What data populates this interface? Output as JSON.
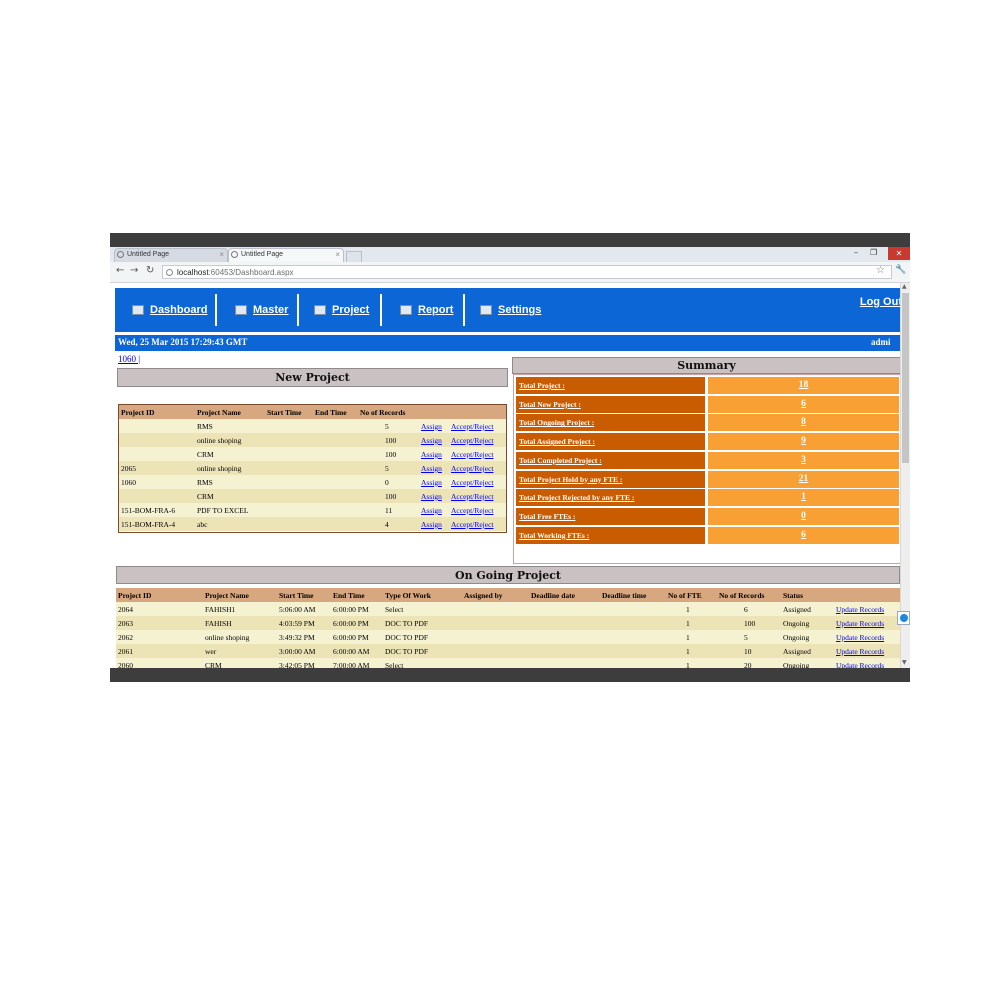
{
  "browser": {
    "tabs": [
      {
        "label": "Untitled Page"
      },
      {
        "label": "Untitled Page"
      }
    ],
    "url_host": "localhost",
    "url_path": ":60453/Dashboard.aspx"
  },
  "nav": {
    "items": [
      {
        "label": "Dashboard",
        "icon": "monitor-icon"
      },
      {
        "label": "Master",
        "icon": "monitor-icon"
      },
      {
        "label": "Project",
        "icon": "project-icon"
      },
      {
        "label": "Report",
        "icon": "report-icon"
      },
      {
        "label": "Settings",
        "icon": "settings-icon"
      }
    ],
    "logout": "Log Out"
  },
  "datebar": {
    "date": "Wed, 25 Mar 2015 17:29:43 GMT",
    "user": "admi"
  },
  "breadcrumb_link": "1060 |",
  "new_project": {
    "title": "New Project",
    "columns": [
      "Project ID",
      "Project Name",
      "Start Time",
      "End Time",
      "No of Records"
    ],
    "rows": [
      {
        "id": "",
        "name": "RMS",
        "start": "",
        "end": "",
        "records": "5",
        "assign": "Assign",
        "accept": "Accept/Reject"
      },
      {
        "id": "",
        "name": "online shoping",
        "start": "",
        "end": "",
        "records": "100",
        "assign": "Assign",
        "accept": "Accept/Reject"
      },
      {
        "id": "",
        "name": "CRM",
        "start": "",
        "end": "",
        "records": "100",
        "assign": "Assign",
        "accept": "Accept/Reject"
      },
      {
        "id": "2065",
        "name": "online shoping",
        "start": "",
        "end": "",
        "records": "5",
        "assign": "Assign",
        "accept": "Accept/Reject"
      },
      {
        "id": "1060",
        "name": "RMS",
        "start": "",
        "end": "",
        "records": "0",
        "assign": "Assign",
        "accept": "Accept/Reject"
      },
      {
        "id": "",
        "name": "CRM",
        "start": "",
        "end": "",
        "records": "100",
        "assign": "Assign",
        "accept": "Accept/Reject"
      },
      {
        "id": "151-BOM-FRA-6",
        "name": "PDF TO EXCEL",
        "start": "",
        "end": "",
        "records": "11",
        "assign": "Assign",
        "accept": "Accept/Reject"
      },
      {
        "id": "151-BOM-FRA-4",
        "name": "abc",
        "start": "",
        "end": "",
        "records": "4",
        "assign": "Assign",
        "accept": "Accept/Reject"
      }
    ]
  },
  "summary": {
    "title": "Summary",
    "rows": [
      {
        "label": "Total Project :",
        "value": "18"
      },
      {
        "label": "Total New Project :",
        "value": "6"
      },
      {
        "label": "Total Ongoing Project :",
        "value": "8"
      },
      {
        "label": "Total Assigned Project :",
        "value": "9"
      },
      {
        "label": "Total Completed Project :",
        "value": "3"
      },
      {
        "label": "Total Project Hold by any FTE :",
        "value": "21"
      },
      {
        "label": "Total Project Rejected by any FTE :",
        "value": "1"
      },
      {
        "label": "Total Free FTEs :",
        "value": "0"
      },
      {
        "label": "Total Working FTEs :",
        "value": "6"
      }
    ]
  },
  "ongoing": {
    "title": "On Going Project",
    "columns": [
      "Project ID",
      "Project Name",
      "Start Time",
      "End Time",
      "Type Of Work",
      "Assigned by",
      "Deadline date",
      "Deadline time",
      "No of FTE",
      "No of Records",
      "Status"
    ],
    "rows": [
      {
        "id": "2064",
        "name": "FAHISH1",
        "start": "5:06:00 AM",
        "end": "6:00:00 PM",
        "type": "Select",
        "fte": "1",
        "records": "6",
        "status": "Assigned",
        "action": "Update Records"
      },
      {
        "id": "2063",
        "name": "FAHISH",
        "start": "4:03:59 PM",
        "end": "6:00:00 PM",
        "type": "DOC TO PDF",
        "fte": "1",
        "records": "100",
        "status": "Ongoing",
        "action": "Update Records"
      },
      {
        "id": "2062",
        "name": "online shoping",
        "start": "3:49:32 PM",
        "end": "6:00:00 PM",
        "type": "DOC TO PDF",
        "fte": "1",
        "records": "5",
        "status": "Ongoing",
        "action": "Update Records"
      },
      {
        "id": "2061",
        "name": "wer",
        "start": "3:00:00 AM",
        "end": "6:00:00 AM",
        "type": "DOC TO PDF",
        "fte": "1",
        "records": "10",
        "status": "Assigned",
        "action": "Update Records"
      },
      {
        "id": "2060",
        "name": "CRM",
        "start": "3:42:05 PM",
        "end": "7:00:00 AM",
        "type": "Select",
        "fte": "1",
        "records": "20",
        "status": "Ongoing",
        "action": "Update Records"
      }
    ]
  },
  "colors": {
    "nav_blue": "#0c66d6",
    "summary_label": "#c95c00",
    "summary_value": "#f9a035",
    "table_header": "#d7a77f",
    "row_light": "#f5f2d2",
    "row_dark": "#ece4b6"
  }
}
